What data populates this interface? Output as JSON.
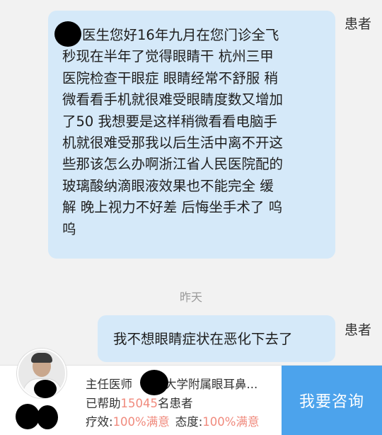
{
  "chat": {
    "sender_label_1": "患者",
    "message_1_lines": [
      "医生您好16年九月在您门诊全飞",
      "秒现在半年了觉得眼睛干 杭州三甲",
      "医院检查干眼症 眼睛经常不舒服 稍",
      "微看看手机就很难受眼睛度数又增加",
      "了50 我想要是这样稍微看看电脑手",
      "机就很难受那我以后生活中离不开这",
      "些那该怎么办啊浙江省人民医院配的",
      "玻璃酸纳滴眼液效果也不能完全 缓",
      "解 晚上视力不好差 后悔坐手术了 呜",
      "呜"
    ],
    "time_divider": "昨天",
    "sender_label_2": "患者",
    "message_2": "我不想眼睛症状在恶化下去了"
  },
  "doctor_panel": {
    "title_prefix": "主任医师",
    "hospital_suffix": "大学附属眼耳鼻...",
    "helped_prefix": "已帮助",
    "helped_count": "15045",
    "helped_suffix": "名患者",
    "efficacy_label": "疗效:",
    "efficacy_value": "100%满意",
    "attitude_label": "态度:",
    "attitude_value": "100%满意",
    "consult_button": "我要咨询"
  }
}
